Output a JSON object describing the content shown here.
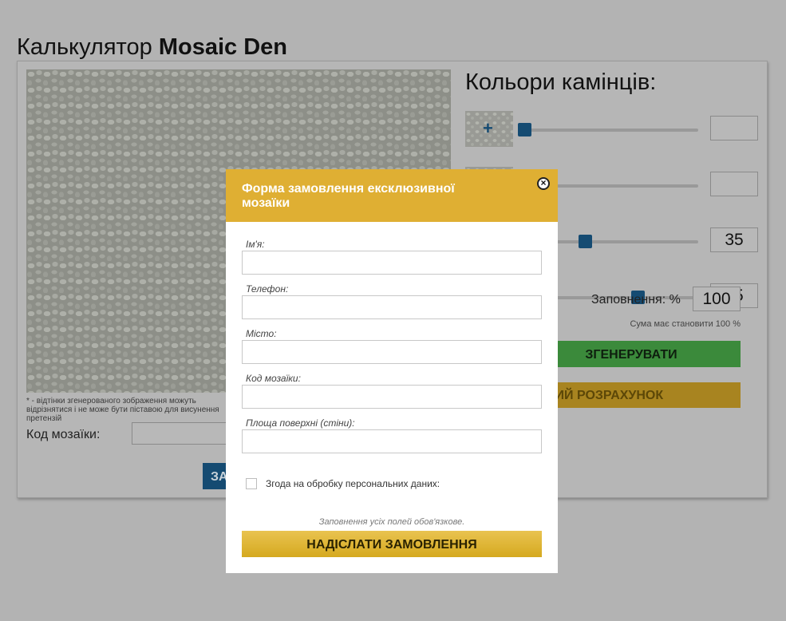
{
  "page": {
    "title_prefix": "Калькулятор ",
    "title_brand": "Mosaic Den"
  },
  "calculator": {
    "preview_note": "* - відтінки згенерованого зображення можуть відрізнятися і не може бути піставою для висунення претензій",
    "code_label": "Код мозаїки:",
    "order_button": "ЗАМОВИТИ",
    "colors_title": "Кольори камінців:",
    "colors": [
      {
        "value": "",
        "percent": 0
      },
      {
        "value": "",
        "percent": 0
      },
      {
        "value": "35",
        "percent": 35
      },
      {
        "value": "65",
        "percent": 65
      }
    ],
    "fill_label": "Заповнення: %",
    "fill_value": "100",
    "sum_note": "Сума має становити 100 %",
    "generate_button": "ЗГЕНЕРУВАТИ",
    "new_calc_button": "НОВИЙ РОЗРАХУНОК"
  },
  "modal": {
    "title": "Форма замовлення ексклюзивної мозаїки",
    "fields": [
      {
        "label": "Ім'я:",
        "value": ""
      },
      {
        "label": "Телефон:",
        "value": ""
      },
      {
        "label": "Місто:",
        "value": ""
      },
      {
        "label": "Код мозаїки:",
        "value": ""
      },
      {
        "label": "Площа поверхні (стіни):",
        "value": ""
      }
    ],
    "consent_label": "Згода на обробку персональних даних:",
    "required_note": "Заповнення усіх полей обов'язкове.",
    "submit_button": "НАДІСЛАТИ ЗАМОВЛЕННЯ"
  },
  "colors": {
    "accent_blue": "#154b72",
    "modal_header": "#dfaf33",
    "generate_green": "#3b8a3b"
  }
}
